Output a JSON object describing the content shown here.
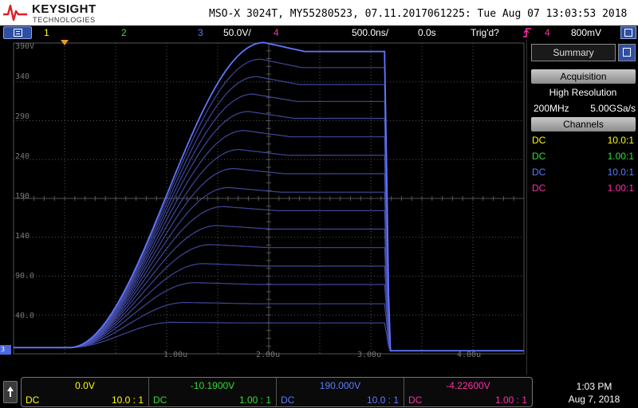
{
  "header": {
    "brand": "KEYSIGHT",
    "brand_sub": "TECHNOLOGIES",
    "title": "MSO-X 3024T, MY55280523, 07.11.2017061225: Tue Aug 07 13:03:53 2018"
  },
  "channel_bar": {
    "ch1": "1",
    "ch2": "2",
    "ch3": "3",
    "ch3_scale": "50.0V/",
    "ch4": "4",
    "timebase": "500.0ns/",
    "delay": "0.0s",
    "trigger_status": "Trig'd?",
    "trigger_channel": "4",
    "trigger_level": "800mV"
  },
  "colors": {
    "ch1": "#ffff00",
    "ch2": "#33dd33",
    "ch3": "#5a7cff",
    "ch4": "#ff2ea8",
    "trace": "#5566dd",
    "grid": "#555555",
    "trigger": "#e89a2a"
  },
  "icons": {
    "menu": "menu-icon",
    "panel": "panel-icon",
    "trigger_edge": "trigger-edge-icon",
    "scroll_up": "arrow-up-icon",
    "logo": "keysight-wave-icon"
  },
  "markers": {
    "ch3_ground": "3"
  },
  "plot": {
    "y_labels": [
      "390V",
      "340",
      "290",
      "240",
      "190",
      "140",
      "90.0",
      "40.0"
    ],
    "x_labels": [
      "1.00u",
      "2.00u",
      "3.00u",
      "4.00u"
    ]
  },
  "chart_data": {
    "type": "line",
    "xlabel": "",
    "ylabel": "",
    "x_unit": "s",
    "y_unit": "V",
    "xlim": [
      0,
      5.5e-06
    ],
    "ylim": [
      -10,
      390
    ],
    "grid": true,
    "family": {
      "pulse_start_s": 6e-07,
      "pulse_end_s": 4e-06,
      "peak_time_s": 2.7e-06,
      "baseline_v": -2,
      "plateau_levels_v": [
        30,
        55,
        80,
        104,
        128,
        152,
        176,
        200,
        224,
        248,
        272,
        296,
        318,
        340,
        362,
        383
      ]
    }
  },
  "panel": {
    "summary_tab": "Summary",
    "acquisition_header": "Acquisition",
    "acq_mode": "High Resolution",
    "bandwidth": "200MHz",
    "sample_rate": "5.00GSa/s",
    "channels_header": "Channels",
    "channels": [
      {
        "coupling": "DC",
        "probe": "10.0:1"
      },
      {
        "coupling": "DC",
        "probe": "1.00:1"
      },
      {
        "coupling": "DC",
        "probe": "10.0:1"
      },
      {
        "coupling": "DC",
        "probe": "1.00:1"
      }
    ]
  },
  "bottom": {
    "channels": [
      {
        "offset": "0.0V",
        "coupling": "DC",
        "probe": "10.0 : 1"
      },
      {
        "offset": "-10.1900V",
        "coupling": "DC",
        "probe": "1.00 : 1"
      },
      {
        "offset": "190.000V",
        "coupling": "DC",
        "probe": "10.0 : 1"
      },
      {
        "offset": "-4.22600V",
        "coupling": "DC",
        "probe": "1.00 : 1"
      }
    ],
    "time": "1:03 PM",
    "date": "Aug 7, 2018"
  }
}
